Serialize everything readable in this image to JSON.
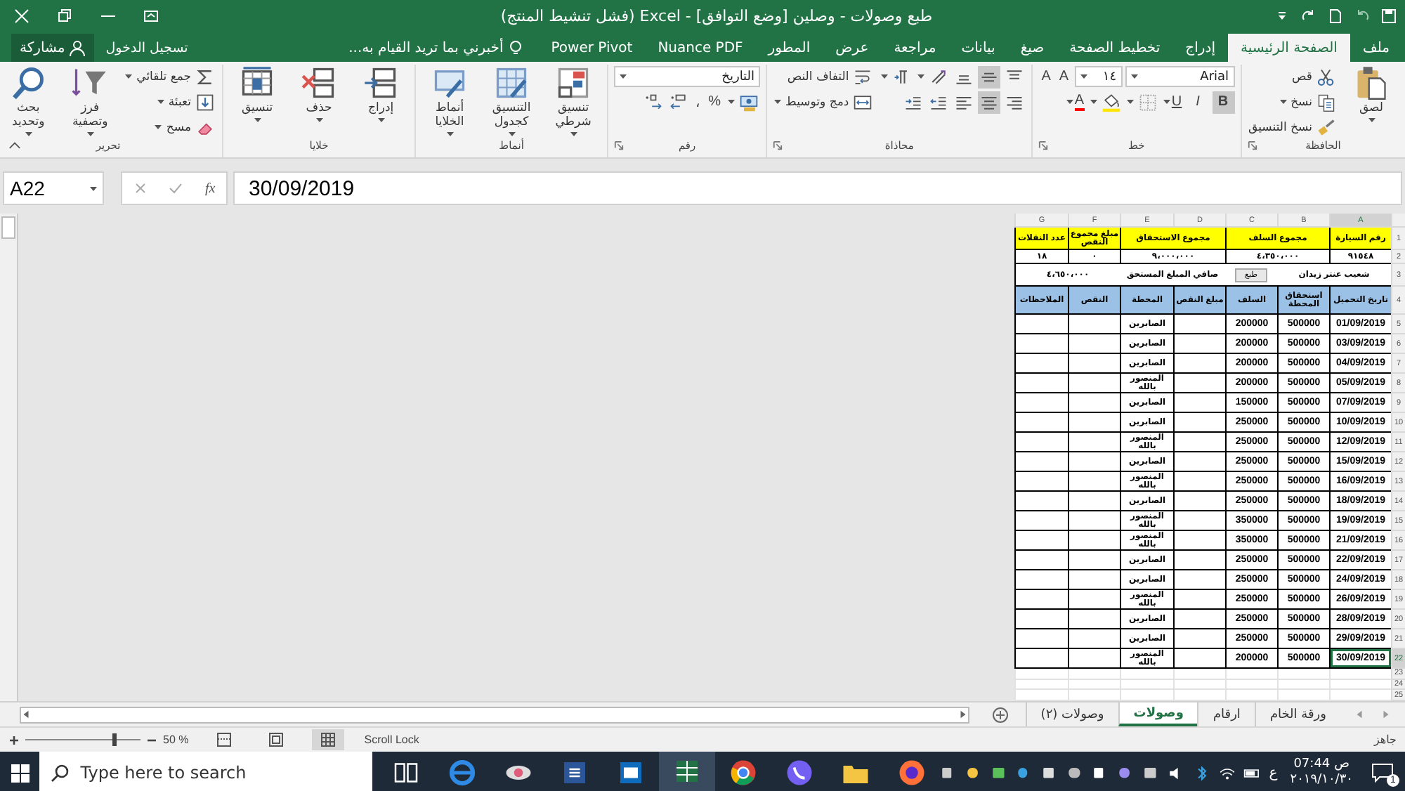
{
  "title_bar": {
    "title": "طبع وصولات - وصلين  [وضع التوافق] - Excel (فشل تنشيط المنتج)"
  },
  "ribbon_tabs": [
    {
      "label": "ملف",
      "selected": false
    },
    {
      "label": "الصفحة الرئيسية",
      "selected": true
    },
    {
      "label": "إدراج",
      "selected": false
    },
    {
      "label": "تخطيط الصفحة",
      "selected": false
    },
    {
      "label": "صيغ",
      "selected": false
    },
    {
      "label": "بيانات",
      "selected": false
    },
    {
      "label": "مراجعة",
      "selected": false
    },
    {
      "label": "عرض",
      "selected": false
    },
    {
      "label": "المطور",
      "selected": false
    },
    {
      "label": "Nuance PDF",
      "selected": false
    },
    {
      "label": "Power Pivot",
      "selected": false
    }
  ],
  "tell_me": "أخبرني بما تريد القيام به...",
  "sign_in": "تسجيل الدخول",
  "share": "مشاركة",
  "ribbon_groups": [
    {
      "label": "الحافظة",
      "launcher": true,
      "columns": [
        {
          "kind": "large",
          "label": "لصق",
          "dropdown": true
        },
        {
          "kind": "stack",
          "rows": [
            [
              {
                "kind": "button",
                "label": "قص",
                "dropdown": false
              }
            ],
            [
              {
                "kind": "button",
                "label": "نسخ",
                "dropdown": true
              }
            ],
            [
              {
                "kind": "button",
                "label": "نسخ التنسيق",
                "dropdown": false
              }
            ]
          ]
        }
      ]
    },
    {
      "label": "خط",
      "launcher": true,
      "columns": [
        {
          "kind": "stack",
          "rows": [
            [
              {
                "kind": "wide-field",
                "value": "Arial"
              },
              {
                "kind": "narrow-field",
                "value": "١٤"
              },
              {
                "kind": "glyph",
                "label": "A"
              },
              {
                "kind": "glyph",
                "label": "A"
              }
            ],
            [
              {
                "kind": "toggle",
                "label": "B",
                "selected": true,
                "dropdown": false
              },
              {
                "kind": "toggle",
                "label": "I",
                "selected": false,
                "dropdown": false
              },
              {
                "kind": "toggle",
                "label": "U",
                "selected": false,
                "dropdown": true
              },
              {
                "kind": "button",
                "dropdown": true
              },
              {
                "kind": "button",
                "dropdown": true
              },
              {
                "kind": "color-glyph",
                "label": "A",
                "dropdown": true
              }
            ]
          ]
        }
      ]
    },
    {
      "label": "محاذاة",
      "launcher": true,
      "columns": [
        {
          "kind": "stack",
          "rows": [
            [
              {
                "kind": "toggle-icon",
                "selected": false
              },
              {
                "kind": "toggle-icon",
                "selected": true
              },
              {
                "kind": "toggle-icon",
                "selected": false
              },
              {
                "kind": "button",
                "dropdown": true
              },
              {
                "kind": "button",
                "dropdown": true
              }
            ],
            [
              {
                "kind": "toggle-icon",
                "selected": false
              },
              {
                "kind": "toggle-icon",
                "selected": true
              },
              {
                "kind": "toggle-icon",
                "selected": false
              },
              {
                "kind": "button",
                "dropdown": false
              },
              {
                "kind": "button",
                "dropdown": false
              }
            ]
          ]
        },
        {
          "kind": "stack",
          "rows": [
            [
              {
                "kind": "button",
                "label": "التفاف النص",
                "dropdown": false
              }
            ],
            [
              {
                "kind": "button",
                "label": "دمج وتوسيط",
                "dropdown": true
              }
            ]
          ]
        }
      ]
    },
    {
      "label": "رقم",
      "launcher": true,
      "columns": [
        {
          "kind": "stack",
          "rows": [
            [
              {
                "kind": "format-field",
                "value": "التاريخ"
              }
            ],
            [
              {
                "kind": "button",
                "dropdown": true
              },
              {
                "kind": "glyph",
                "label": "%"
              },
              {
                "kind": "glyph",
                "label": "،"
              },
              {
                "kind": "button",
                "dropdown": false
              },
              {
                "kind": "button",
                "dropdown": false
              }
            ]
          ]
        }
      ]
    },
    {
      "label": "أنماط",
      "launcher": false,
      "columns": [
        {
          "kind": "large",
          "label": "تنسيق شرطي",
          "dropdown": true
        },
        {
          "kind": "large",
          "label": "التنسيق كجدول",
          "dropdown": true
        },
        {
          "kind": "large",
          "label": "أنماط الخلايا",
          "dropdown": true
        }
      ]
    },
    {
      "label": "خلايا",
      "launcher": false,
      "columns": [
        {
          "kind": "large",
          "label": "إدراج",
          "dropdown": true
        },
        {
          "kind": "large",
          "label": "حذف",
          "dropdown": true
        },
        {
          "kind": "large",
          "label": "تنسيق",
          "dropdown": true
        }
      ]
    },
    {
      "label": "تحرير",
      "launcher": false,
      "columns": [
        {
          "kind": "stack",
          "rows": [
            [
              {
                "kind": "button",
                "label": "جمع تلقائي",
                "dropdown": true
              }
            ],
            [
              {
                "kind": "button",
                "label": "تعبئة",
                "dropdown": true
              }
            ],
            [
              {
                "kind": "button",
                "label": "مسح",
                "dropdown": true
              }
            ]
          ]
        },
        {
          "kind": "large",
          "label": "فرز وتصفية",
          "dropdown": true
        },
        {
          "kind": "large",
          "label": "بحث وتحديد",
          "dropdown": true
        }
      ]
    }
  ],
  "name_box": "A22",
  "function_button": "fx",
  "formula": "30/09/2019",
  "sheet": {
    "columns": [
      "A",
      "B",
      "C",
      "D",
      "E",
      "F",
      "G"
    ],
    "row_numbers": [
      "1",
      "2",
      "3",
      "4",
      "5",
      "6",
      "7",
      "8",
      "9",
      "10",
      "11",
      "12",
      "13",
      "14",
      "15",
      "16",
      "17",
      "18",
      "19",
      "20",
      "21",
      "22",
      "23",
      "24",
      "25"
    ],
    "summary_headers": [
      "رقم السيارة",
      "مجموع السلف",
      "مجموع الاستحقاق",
      "مبلغ مجموع النقص",
      "عدد النقلات"
    ],
    "summary_values": [
      "٩١٥٤٨",
      "٤،٣٥٠،٠٠٠",
      "٩،٠٠٠،٠٠٠",
      "٠",
      "١٨"
    ],
    "driver_name": "شعيب عنتر زيدان",
    "print_button": "طبع",
    "net_label": "صافي المبلغ المستحق",
    "net_value": "٤،٦٥٠،٠٠٠",
    "table_headers": [
      "تاريخ التحميل",
      "استحقاق المحطة",
      "السلف",
      "مبلغ النقص",
      "المحطة",
      "النقص",
      "الملاحظات"
    ],
    "rows": [
      {
        "date": "01/09/2019",
        "due": "500000",
        "advance": "200000",
        "station": "الصابرين",
        "selected": false
      },
      {
        "date": "03/09/2019",
        "due": "500000",
        "advance": "200000",
        "station": "الصابرين",
        "selected": false
      },
      {
        "date": "04/09/2019",
        "due": "500000",
        "advance": "200000",
        "station": "الصابرين",
        "selected": false
      },
      {
        "date": "05/09/2019",
        "due": "500000",
        "advance": "200000",
        "station": "المنصور بالله",
        "selected": false
      },
      {
        "date": "07/09/2019",
        "due": "500000",
        "advance": "150000",
        "station": "الصابرين",
        "selected": false
      },
      {
        "date": "10/09/2019",
        "due": "500000",
        "advance": "250000",
        "station": "الصابرين",
        "selected": false
      },
      {
        "date": "12/09/2019",
        "due": "500000",
        "advance": "250000",
        "station": "المنصور بالله",
        "selected": false
      },
      {
        "date": "15/09/2019",
        "due": "500000",
        "advance": "250000",
        "station": "الصابرين",
        "selected": false
      },
      {
        "date": "16/09/2019",
        "due": "500000",
        "advance": "250000",
        "station": "المنصور بالله",
        "selected": false
      },
      {
        "date": "18/09/2019",
        "due": "500000",
        "advance": "250000",
        "station": "الصابرين",
        "selected": false
      },
      {
        "date": "19/09/2019",
        "due": "500000",
        "advance": "350000",
        "station": "المنصور بالله",
        "selected": false
      },
      {
        "date": "21/09/2019",
        "due": "500000",
        "advance": "350000",
        "station": "المنصور بالله",
        "selected": false
      },
      {
        "date": "22/09/2019",
        "due": "500000",
        "advance": "250000",
        "station": "الصابرين",
        "selected": false
      },
      {
        "date": "24/09/2019",
        "due": "500000",
        "advance": "250000",
        "station": "الصابرين",
        "selected": false
      },
      {
        "date": "26/09/2019",
        "due": "500000",
        "advance": "250000",
        "station": "المنصور بالله",
        "selected": false
      },
      {
        "date": "28/09/2019",
        "due": "500000",
        "advance": "250000",
        "station": "الصابرين",
        "selected": false
      },
      {
        "date": "29/09/2019",
        "due": "500000",
        "advance": "250000",
        "station": "الصابرين",
        "selected": false
      },
      {
        "date": "30/09/2019",
        "due": "500000",
        "advance": "200000",
        "station": "المنصور بالله",
        "selected": true
      }
    ]
  },
  "sheet_tabs": [
    {
      "label": "ورقة الخام",
      "selected": false
    },
    {
      "label": "ارقام",
      "selected": false
    },
    {
      "label": "وصولات",
      "selected": true
    },
    {
      "label": "وصولات (٢)",
      "selected": false
    }
  ],
  "status_bar": {
    "status": "جاهز",
    "scroll_lock": "Scroll Lock",
    "zoom": "50 %",
    "zoom_slider": {
      "level": 0.75
    }
  },
  "taskbar": {
    "search_placeholder": "Type here to search",
    "apps": [
      {
        "selected": false
      },
      {
        "selected": false
      },
      {
        "selected": false
      },
      {
        "selected": false
      },
      {
        "selected": false
      },
      {
        "selected": true
      },
      {
        "selected": false
      },
      {
        "selected": false
      },
      {
        "selected": false
      },
      {
        "selected": false
      }
    ],
    "language": "ع",
    "time": "07:44",
    "period": "ص",
    "date": "٢٠١٩/١٠/٣٠",
    "notifications": "1"
  }
}
